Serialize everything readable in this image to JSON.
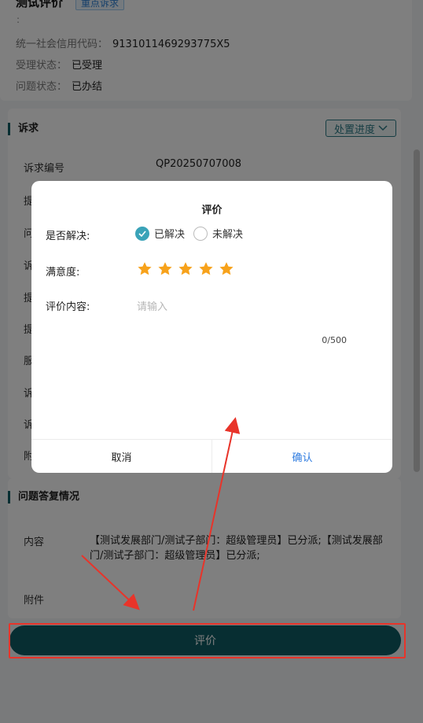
{
  "top": {
    "title": "测试评价",
    "tag": "重点诉求",
    "dot": ":",
    "credit_code_label": "统一社会信用代码：",
    "credit_code_value": "9131011469293775X5",
    "accept_status_label": "受理状态：",
    "accept_status_value": "已受理",
    "issue_status_label": "问题状态：",
    "issue_status_value": "已办结"
  },
  "appeal": {
    "section_title": "诉求",
    "progress_button": "处置进度",
    "number_label": "诉求编号",
    "number_value": "QP20250707008",
    "partial_labels": [
      "提",
      "问",
      "诉",
      "提",
      "提",
      "服",
      "诉",
      "诉",
      "附"
    ]
  },
  "answer": {
    "section_title": "问题答复情况",
    "content_label": "内容",
    "content_value": "【测试发展部门/测试子部门：超级管理员】已分派;【测试发展部门/测试子部门：超级管理员】已分派;",
    "attachment_label": "附件"
  },
  "bottom": {
    "evaluate_button": "评价"
  },
  "dialog": {
    "title": "评价",
    "resolved_label": "是否解决:",
    "option_resolved": "已解决",
    "option_unresolved": "未解决",
    "selected": "已解决",
    "satisfaction_label": "满意度:",
    "rating": 5,
    "rating_max": 5,
    "content_label": "评价内容:",
    "content_placeholder": "请输入",
    "counter": "0/500",
    "cancel": "取消",
    "confirm": "确认"
  },
  "colors": {
    "primary": "#0f5d64",
    "radio_checked": "#3aa3b8",
    "star": "#f7a21b",
    "confirm_text": "#2f7ce0",
    "annotation_red": "#e8342a"
  }
}
